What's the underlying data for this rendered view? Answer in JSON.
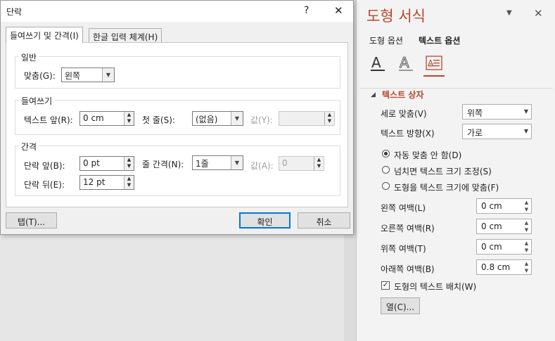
{
  "colors": {
    "accent": "#b7472a",
    "primary_border": "#0078d7"
  },
  "dialog": {
    "title": "단락",
    "help": "?",
    "close": "✕",
    "tabs": [
      "들여쓰기 및 간격(I)",
      "한글 입력 체계(H)"
    ],
    "general": {
      "title": "일반",
      "align_label": "맞춤(G):",
      "align_value": "왼쪽"
    },
    "indent": {
      "title": "들여쓰기",
      "before_label": "텍스트 앞(R):",
      "before_value": "0 cm",
      "special_label": "첫 줄(S):",
      "special_value": "(없음)",
      "by_label": "값(Y):",
      "by_value": ""
    },
    "spacing": {
      "title": "간격",
      "before_label": "단락 앞(B):",
      "before_value": "0 pt",
      "after_label": "단락 뒤(E):",
      "after_value": "12 pt",
      "line_label": "줄 간격(N):",
      "line_value": "1줄",
      "at_label": "값(A):",
      "at_value": "0"
    },
    "tabs_button": "탭(T)...",
    "ok_button": "확인",
    "cancel_button": "취소"
  },
  "pane": {
    "title": "도형 서식",
    "tabs": [
      "도형 옵션",
      "텍스트 옵션"
    ],
    "icons": [
      "text-fill-icon",
      "text-outline-icon",
      "textbox-icon"
    ],
    "section_title": "텍스트 상자",
    "vertical_align_label": "세로 맞춤(V)",
    "vertical_align_value": "위쪽",
    "text_direction_label": "텍스트 방향(X)",
    "text_direction_value": "가로",
    "autofit_options": [
      "자동 맞춤 안 함(D)",
      "넘치면 텍스트 크기 조정(S)",
      "도형을 텍스트 크기에 맞춤(F)"
    ],
    "autofit_selected": 0,
    "left_margin_label": "왼쪽 여백(L)",
    "left_margin_value": "0 cm",
    "right_margin_label": "오른쪽 여백(R)",
    "right_margin_value": "0 cm",
    "top_margin_label": "위쪽 여백(T)",
    "top_margin_value": "0 cm",
    "bottom_margin_label": "아래쪽 여백(B)",
    "bottom_margin_value": "0.8 cm",
    "wrap_label": "도형의 텍스트 배치(W)",
    "wrap_checked": true,
    "columns_button": "열(C)..."
  }
}
